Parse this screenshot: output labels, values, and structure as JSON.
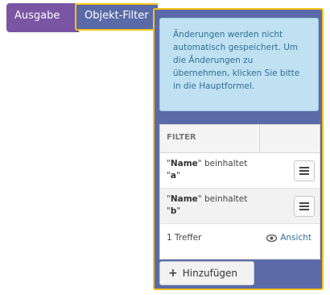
{
  "tabs": {
    "ausgabe": "Ausgabe",
    "objekt_filter": "Objekt-Filter"
  },
  "info": {
    "text": "Änderungen werden nicht automatisch gespeichert. Um die Änderungen zu übernehmen, klicken Sie bitte in die Hauptformel."
  },
  "table": {
    "header": "FILTER",
    "rows": [
      {
        "field": "Name",
        "operator": "beinhaltet",
        "value": "a"
      },
      {
        "field": "Name",
        "operator": "beinhaltet",
        "value": "b"
      }
    ],
    "count": "1 Treffer",
    "view_label": "Ansicht"
  },
  "add_button": "Hinzufügen",
  "colors": {
    "ausgabe_tab": "#7a55a3",
    "filter_panel": "#5a6aa8",
    "highlight_border": "#f4c21a",
    "info_bg": "#bfe1f1",
    "link": "#2f6f9a"
  },
  "icons": {
    "row_menu": "hamburger-icon",
    "view": "eye-icon",
    "add": "plus-icon"
  }
}
